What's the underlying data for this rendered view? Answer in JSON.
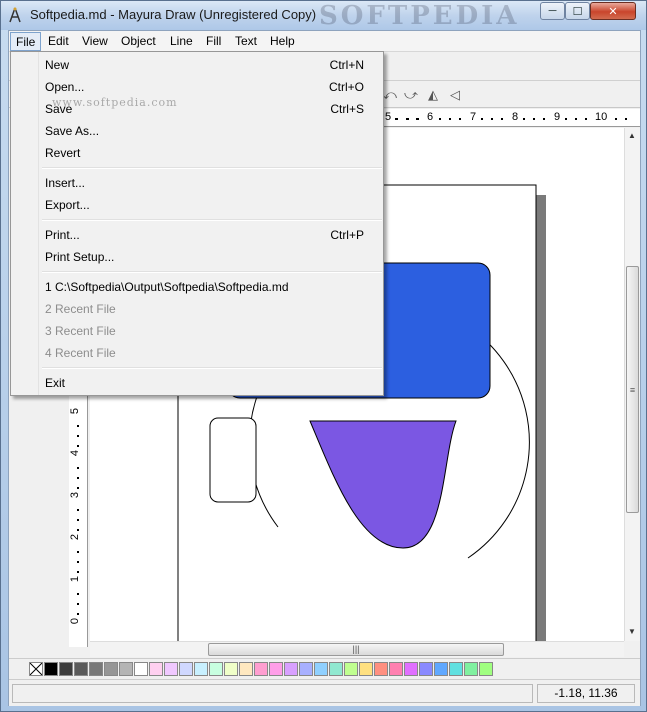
{
  "window": {
    "title": "Softpedia.md - Mayura Draw (Unregistered Copy)",
    "watermark": "SOFTPEDIA",
    "controls": {
      "minimize": "─",
      "maximize": "☐",
      "close": "✕"
    }
  },
  "menubar": {
    "items": [
      "File",
      "Edit",
      "View",
      "Object",
      "Line",
      "Fill",
      "Text",
      "Help"
    ],
    "active": "File"
  },
  "file_menu": {
    "items": [
      {
        "label": "New",
        "shortcut": "Ctrl+N"
      },
      {
        "label": "Open...",
        "shortcut": "Ctrl+O"
      },
      {
        "label": "Save",
        "shortcut": "Ctrl+S"
      },
      {
        "label": "Save As...",
        "shortcut": ""
      },
      {
        "label": "Revert",
        "shortcut": ""
      },
      {
        "label": "Insert...",
        "shortcut": ""
      },
      {
        "label": "Export...",
        "shortcut": ""
      },
      {
        "label": "Print...",
        "shortcut": "Ctrl+P"
      },
      {
        "label": "Print Setup...",
        "shortcut": ""
      },
      {
        "label": "1 C:\\Softpedia\\Output\\Softpedia\\Softpedia.md",
        "shortcut": ""
      },
      {
        "label": "2 Recent File",
        "shortcut": ""
      },
      {
        "label": "3 Recent File",
        "shortcut": ""
      },
      {
        "label": "4 Recent File",
        "shortcut": ""
      },
      {
        "label": "Exit",
        "shortcut": ""
      }
    ],
    "watermark": "www.softpedia.com"
  },
  "rulers": {
    "horizontal": [
      "5",
      "6",
      "7",
      "8",
      "9",
      "10"
    ],
    "vertical": [
      "5",
      "4",
      "3",
      "2",
      "1",
      "0"
    ]
  },
  "palette": {
    "colors": [
      "#000000",
      "#3c3c3c",
      "#5a5a5a",
      "#787878",
      "#969696",
      "#b4b4b4",
      "#ffffff",
      "#ffd0f0",
      "#f0c8ff",
      "#d0d8ff",
      "#c8f0ff",
      "#c8ffe0",
      "#f0ffc8",
      "#ffe8c0",
      "#ff9ed0",
      "#ff9ee8",
      "#d8a0ff",
      "#a8b0ff",
      "#90d0ff",
      "#90e8d0",
      "#c0ff90",
      "#ffe080",
      "#ff9080",
      "#ff80b0",
      "#e070ff",
      "#8a8aff",
      "#60a8ff",
      "#60e0e0",
      "#80f0a0",
      "#a0ff80"
    ]
  },
  "status": {
    "coords": "-1.18, 11.36"
  },
  "colors": {
    "blue_rect": "#2c5fe0",
    "purple_shape": "#7b57e3",
    "page_shadow": "#7a7a7a"
  }
}
